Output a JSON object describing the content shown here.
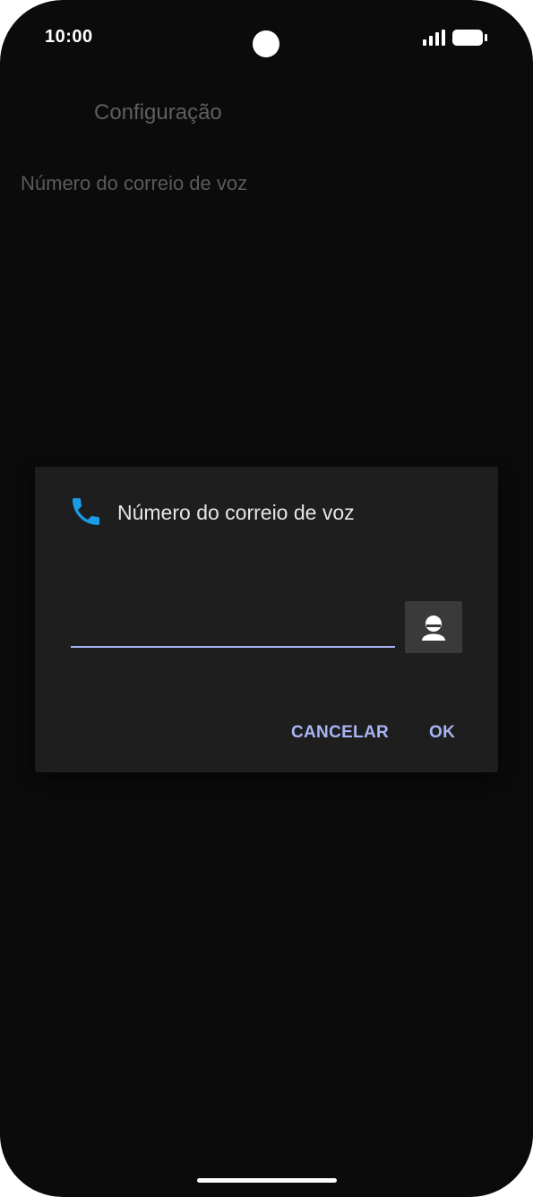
{
  "status_bar": {
    "time": "10:00",
    "signal_icon": "signal-bars-icon",
    "battery_icon": "battery-icon"
  },
  "background": {
    "title": "Configuração",
    "item": "Número do correio de voz"
  },
  "dialog": {
    "icon": "phone-icon",
    "title": "Número do correio de voz",
    "input_value": "",
    "contact_icon": "contact-person-icon",
    "cancel_label": "CANCELAR",
    "ok_label": "OK"
  },
  "colors": {
    "accent": "#a9b4f5",
    "phone_icon": "#1a9be6",
    "dialog_bg": "#1e1e1e",
    "screen_bg": "#0b0b0b"
  }
}
